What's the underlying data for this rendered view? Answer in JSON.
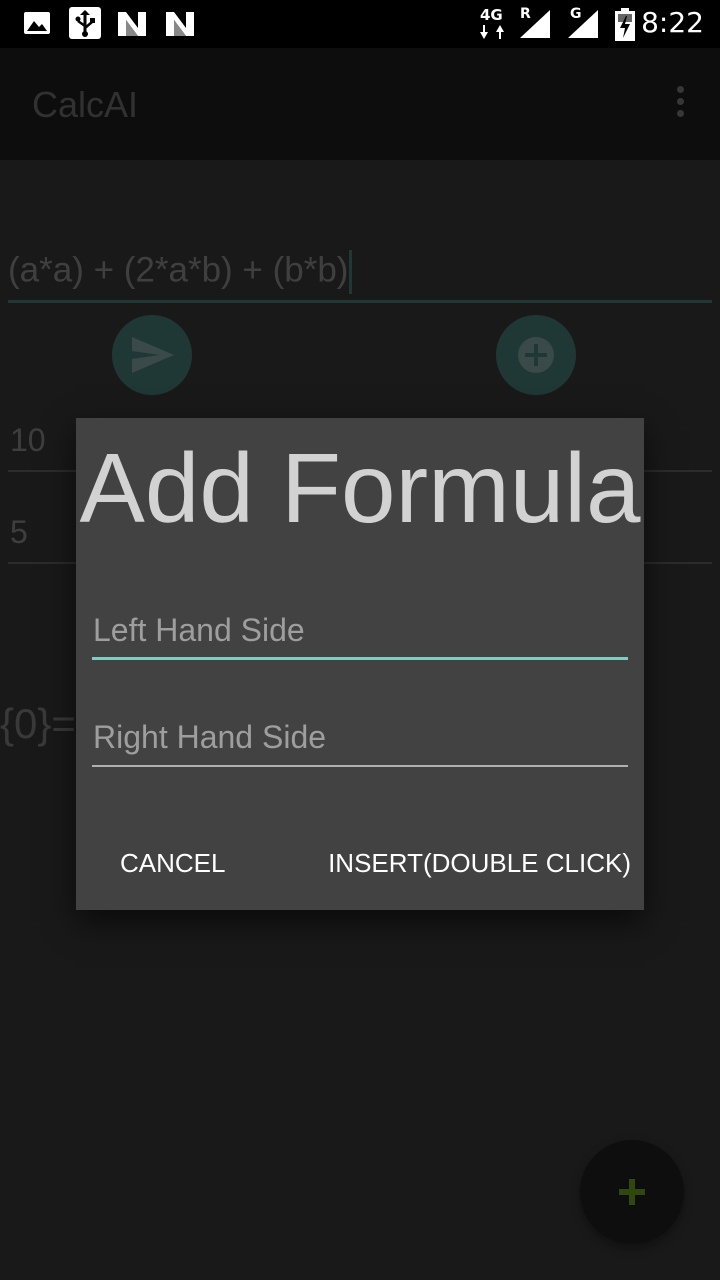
{
  "status_bar": {
    "time": "8:22",
    "network_4g": "4G",
    "roaming": "R",
    "network_g": "G",
    "icons": [
      "image-notification-icon",
      "usb-icon",
      "n-notification-icon",
      "n-notification-icon",
      "signal-4g-icon",
      "signal-g-icon",
      "battery-charging-icon"
    ]
  },
  "app_bar": {
    "title": "CalcAI",
    "menu_icon": "overflow-menu-icon"
  },
  "main": {
    "expression": "(a*a) + (2*a*b) + (b*b)",
    "send_icon": "send-icon",
    "add_icon": "add-circle-icon",
    "variables": [
      {
        "value": "10"
      },
      {
        "value": "5"
      }
    ],
    "result_partial": "{0}=",
    "fab_icon": "plus-icon"
  },
  "dialog": {
    "title": "Add Formula",
    "lhs_placeholder": "Left Hand Side",
    "rhs_placeholder": "Right Hand Side",
    "cancel_label": "CANCEL",
    "insert_label": "INSERT(DOUBLE CLICK)"
  },
  "colors": {
    "accent": "#80cbc4",
    "dialog_bg": "#424242",
    "fab_plus": "#5a8a1a"
  }
}
